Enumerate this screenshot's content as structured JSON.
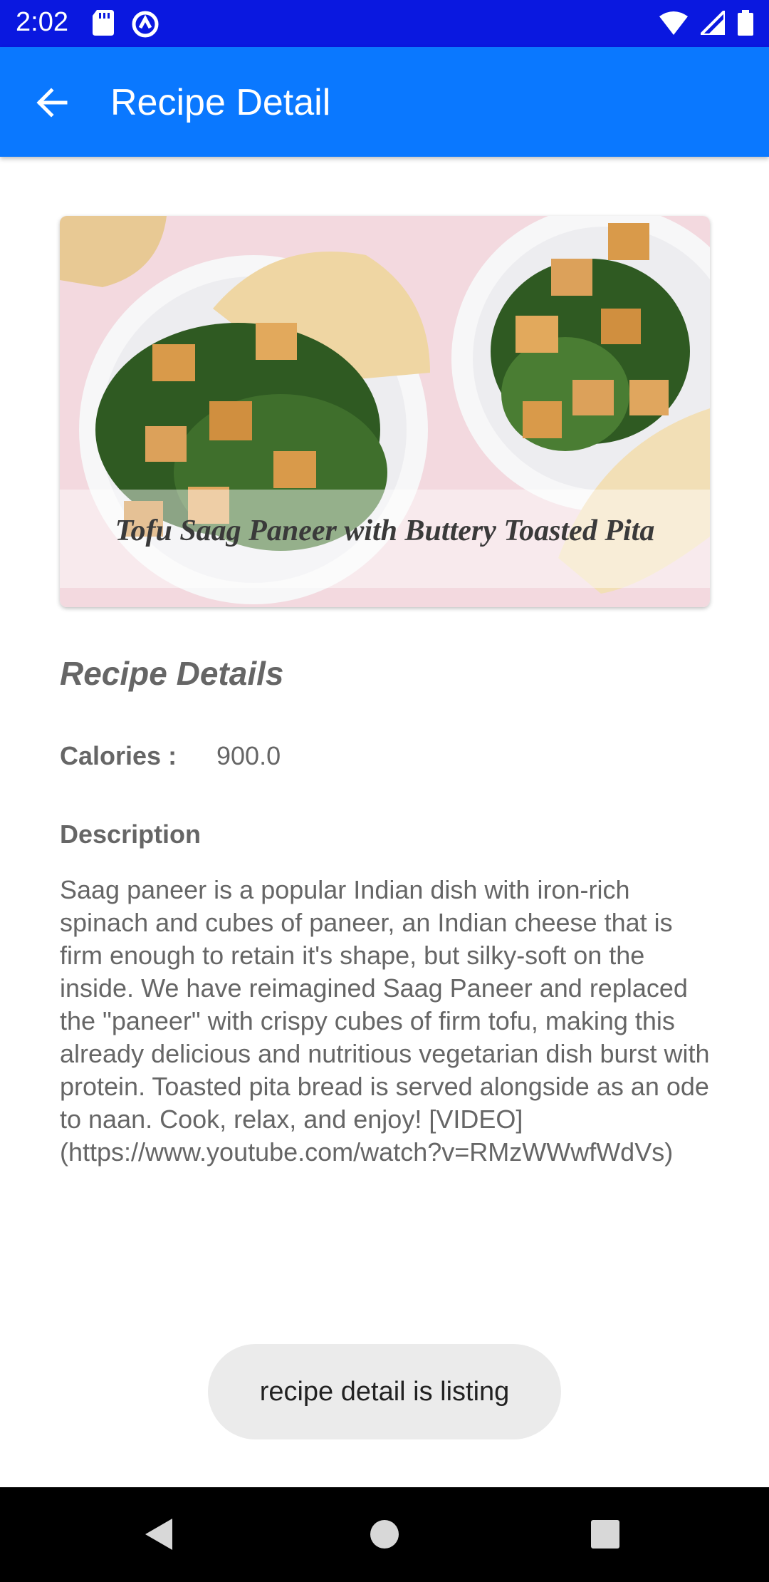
{
  "status_bar": {
    "time": "2:02",
    "left_icons": [
      "sd-card-icon",
      "vpn-icon"
    ],
    "right_icons": [
      "wifi-icon",
      "signal-icon",
      "battery-icon"
    ],
    "background_color": "#0a18e0"
  },
  "app_bar": {
    "title": "Recipe Detail",
    "back_icon": "arrow-back-icon",
    "background_color": "#0a78ff"
  },
  "hero": {
    "caption": "Tofu Saag Paneer with Buttery Toasted Pita"
  },
  "details": {
    "section_title": "Recipe Details",
    "calories_label": "Calories :",
    "calories_value": "900.0",
    "description_label": "Description",
    "description": "Saag paneer is a popular Indian dish with iron-rich spinach and cubes of paneer, an Indian cheese that is firm enough to retain it's shape, but silky-soft on the inside. We have reimagined Saag Paneer and replaced the \"paneer\" with crispy cubes of firm tofu, making this already delicious and nutritious vegetarian dish burst with protein. Toasted pita bread is served alongside as an ode to naan. Cook, relax, and enjoy! [VIDEO](https://www.youtube.com/watch?v=RMzWWwfWdVs)"
  },
  "toast": {
    "message": "recipe detail is listing"
  },
  "nav_bar": {
    "icons": [
      "nav-back-icon",
      "nav-home-icon",
      "nav-recents-icon"
    ]
  }
}
